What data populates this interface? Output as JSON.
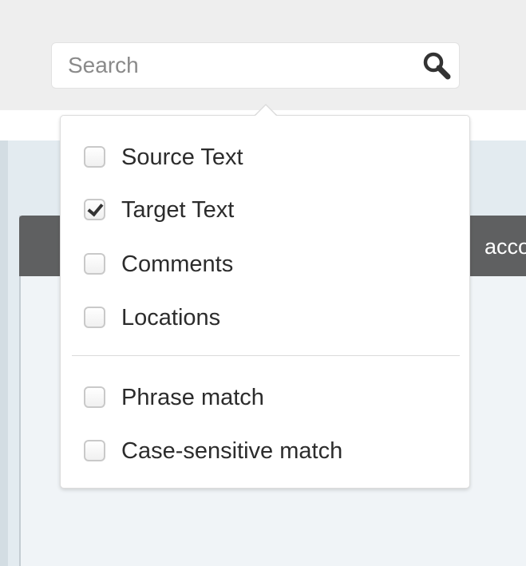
{
  "search": {
    "placeholder": "Search",
    "value": ""
  },
  "background": {
    "header_text": "acco"
  },
  "filters": {
    "scope_options": [
      {
        "label": "Source Text",
        "checked": false
      },
      {
        "label": "Target Text",
        "checked": true
      },
      {
        "label": "Comments",
        "checked": false
      },
      {
        "label": "Locations",
        "checked": false
      }
    ],
    "match_options": [
      {
        "label": "Phrase match",
        "checked": false
      },
      {
        "label": "Case-sensitive match",
        "checked": false
      }
    ]
  },
  "colors": {
    "topbar_bg": "#eeeeee",
    "panel_bg": "#e3ebf0",
    "card_header_bg": "#5f6061"
  }
}
